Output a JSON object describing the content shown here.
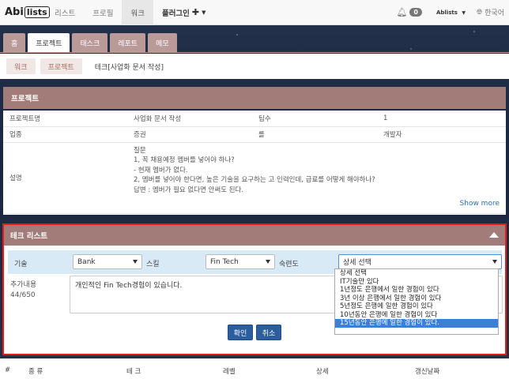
{
  "navbar": {
    "logo_main": "Abi",
    "logo_box": "lists",
    "items": [
      "리스트",
      "프로필",
      "워크",
      "플러그인"
    ],
    "notifications": "0",
    "lang_logo": "Ablists",
    "language": "한국어"
  },
  "tabs": [
    "홈",
    "프로젝트",
    "태스크",
    "레포트",
    "메모"
  ],
  "breadcrumb": [
    "워크",
    "프로젝트",
    "테크[사업화 문서 작성]"
  ],
  "project": {
    "title": "프로젝트",
    "row1": [
      "프로젝트명",
      "사업화 문서 작성",
      "팀수",
      "1"
    ],
    "row2": [
      "업종",
      "증권",
      "롤",
      "개발자"
    ],
    "desc_label": "설명",
    "desc_lines": [
      "질문",
      "1, 꼭 채용예정 멤버를 넣어야 하나?",
      "- 현재 멤버가 없다.",
      "2, 멤버를 넣어야 한다면, 높은 기술을 요구하는 고 인력인데, 급료를 어떻게 해야하나?",
      "답변 : 멤버가 필요 없다면 안써도 된다."
    ],
    "show_more": "Show more"
  },
  "tech": {
    "title": "테크 리스트",
    "label_skill": "기술",
    "skill_value": "Bank",
    "label_skill2": "스킬",
    "skill2_value": "Fin Tech",
    "label_level": "숙련도",
    "level_value": "상세 선택",
    "extra_label": "추가내용",
    "extra_count": "44/650",
    "extra_text": "개인적인 Fin Tech경험이 있습니다.",
    "confirm": "확인",
    "cancel": "취소",
    "level_options": [
      "상세 선택",
      "IT기술만 있다",
      "1년정도 은행에서 일한 경험이 있다",
      "3년 이상 은행에서 일한 경험이 있다",
      "5년정도 은행에 일한 경험이 있다",
      "10년동안 은행에 일한 경험이 있다",
      "15년동안 은행에 일한 경험이 있다."
    ],
    "selected_option_index": 6
  },
  "bottom_table": {
    "headers": [
      "#",
      "종 류",
      "테 크",
      "레벨",
      "상세",
      "갱신날짜"
    ]
  }
}
